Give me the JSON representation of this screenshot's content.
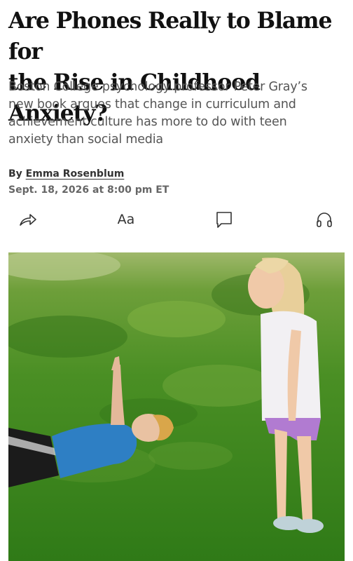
{
  "article": {
    "headline_line1": "Are Phones Really to Blame for",
    "headline_line2": "the Rise in Childhood Anxiety?",
    "dek_lines": [
      "Boston College psychology professor Peter Gray’s",
      "new book argues that change in curriculum and",
      "achievement culture has more to do with teen",
      "anxiety than social media"
    ],
    "byline_prefix": "By ",
    "author": "Emma Rosenblum",
    "date": "Sept. 18, 2026 at 8:00 pm ET"
  },
  "toolbar": {
    "items": [
      {
        "name": "share",
        "icon": "share-arrow-icon"
      },
      {
        "name": "text-size",
        "label": "Aa"
      },
      {
        "name": "comments",
        "icon": "comment-icon"
      },
      {
        "name": "listen",
        "icon": "headphones-icon"
      }
    ]
  },
  "photo": {
    "icon": "hero-photo"
  },
  "colors": {
    "grass": "#3f8a1f",
    "shirt_blue": "#2e7fc4",
    "text": "#111111",
    "dek": "#555555"
  }
}
